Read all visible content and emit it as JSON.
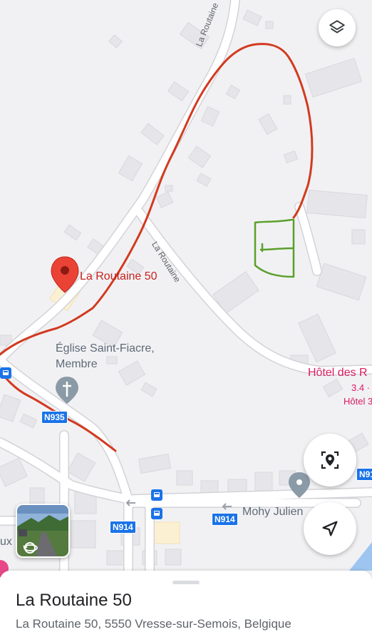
{
  "map": {
    "place_marker_label": "La Routaine 50",
    "church_label_line1": "Église Saint-Fiacre,",
    "church_label_line2": "Membre",
    "hotel_label": "Hôtel des R",
    "hotel_rating": "3.4 ·",
    "hotel_stars": "Hôtel 3",
    "poi_label_right": "Mohy Julien",
    "partial_label_left": "ux",
    "road_labels": {
      "top": "La Routaine",
      "middle": "La Routaine"
    },
    "route_shields": {
      "n935": "N935",
      "n914": "N914",
      "n914_2": "N914",
      "n9x": "N91"
    },
    "colors": {
      "red_line": "#d23a1f",
      "green_box": "#5aa02c",
      "marker": "#ea4335",
      "hotel_text": "#d81b60",
      "shield": "#1a73e8"
    },
    "icons": {
      "layers": "layers-icon",
      "locate": "my-location-icon",
      "navigate": "navigation-arrow-icon",
      "street_view": "street-view-rotate-icon"
    }
  },
  "sheet": {
    "title": "La Routaine 50",
    "address": "La Routaine 50, 5550 Vresse-sur-Semois, Belgique"
  }
}
